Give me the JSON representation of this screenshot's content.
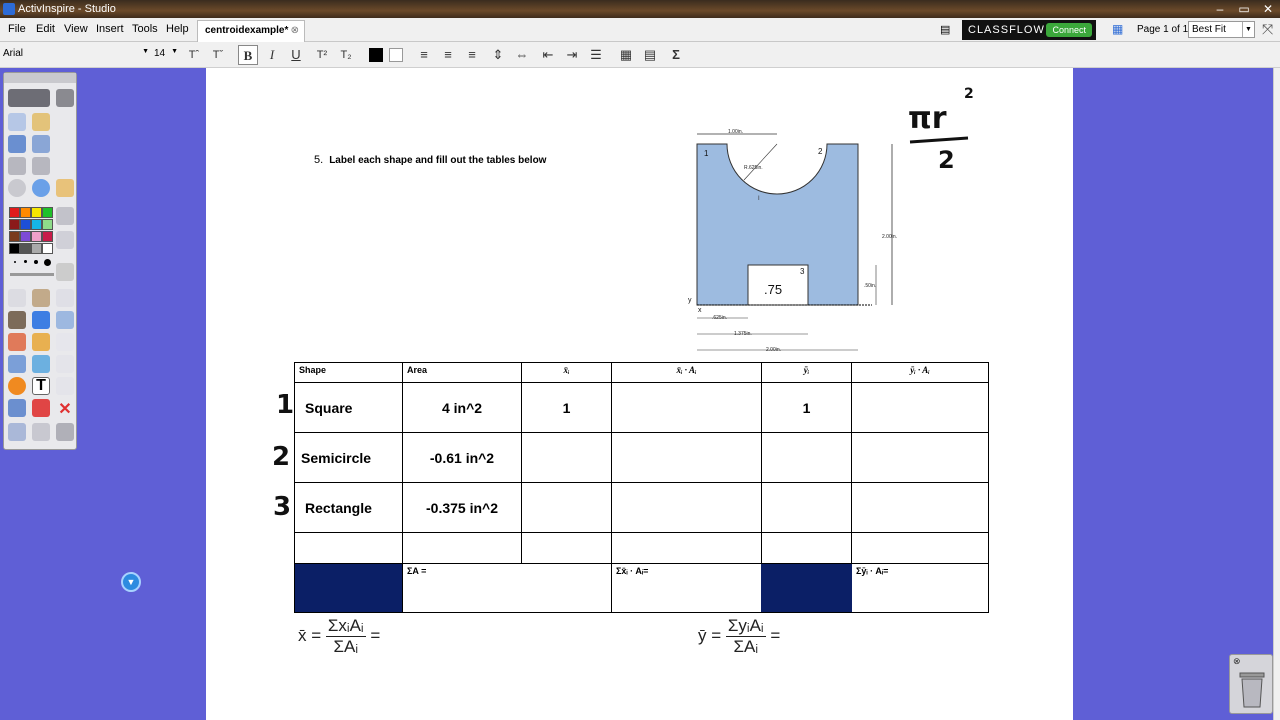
{
  "window": {
    "title": "ActivInspire - Studio"
  },
  "menu": [
    "File",
    "Edit",
    "View",
    "Insert",
    "Tools",
    "Help"
  ],
  "tab": {
    "label": "centroidexample*"
  },
  "classflow": {
    "label": "CLASSFLOW",
    "connect": "Connect"
  },
  "page_info": "Page 1 of 1",
  "zoom": "Best Fit",
  "format": {
    "font": "Arial",
    "size": "14"
  },
  "question": {
    "number": "5.",
    "text": "Label each shape and fill out the tables below"
  },
  "handwriting": {
    "pi_formula_top": "πr",
    "pi_formula_exp": "2",
    "pi_formula_bottom": "2"
  },
  "figure": {
    "dim_top": "1.00in.",
    "dim_radius": "R.625in.",
    "label_1": "1",
    "label_2": "2",
    "label_3": "3",
    "rect_value": ".75",
    "dim_right": "2.00in.",
    "dim_small": ".50in.",
    "dim_b1": ".625in.",
    "dim_b2": "1.375in.",
    "dim_b3": "2.00in.",
    "axis_y": "y",
    "axis_x": "x"
  },
  "table": {
    "headers": [
      "Shape",
      "Area",
      "x̄ᵢ",
      "x̄ᵢ · Aᵢ",
      "ȳᵢ",
      "ȳᵢ · Aᵢ"
    ],
    "rows": [
      {
        "shape": "Square",
        "area": "4 in^2",
        "x": "1",
        "xa": "",
        "y": "1",
        "ya": "",
        "hand": "1"
      },
      {
        "shape": "Semicircle",
        "area": "-0.61 in^2",
        "x": "",
        "xa": "",
        "y": "",
        "ya": "",
        "hand": "2"
      },
      {
        "shape": "Rectangle",
        "area": "-0.375 in^2",
        "x": "",
        "xa": "",
        "y": "",
        "ya": "",
        "hand": "3"
      }
    ],
    "sum_area": "ΣA =",
    "sum_xa": "Σx̄ᵢ · Aᵢ=",
    "sum_ya": "Σȳᵢ · Aᵢ="
  },
  "formulas": {
    "xbar_lhs": "x̄ =",
    "xbar_num": "ΣxᵢAᵢ",
    "xbar_den": "ΣAᵢ",
    "xbar_eq": "=",
    "ybar_lhs": "ȳ =",
    "ybar_num": "ΣyᵢAᵢ",
    "ybar_den": "ΣAᵢ",
    "ybar_eq": "="
  },
  "colors": {
    "navy": "#0b1f66",
    "shape_fill": "#9dbbe0",
    "background": "#5f5fd6"
  }
}
